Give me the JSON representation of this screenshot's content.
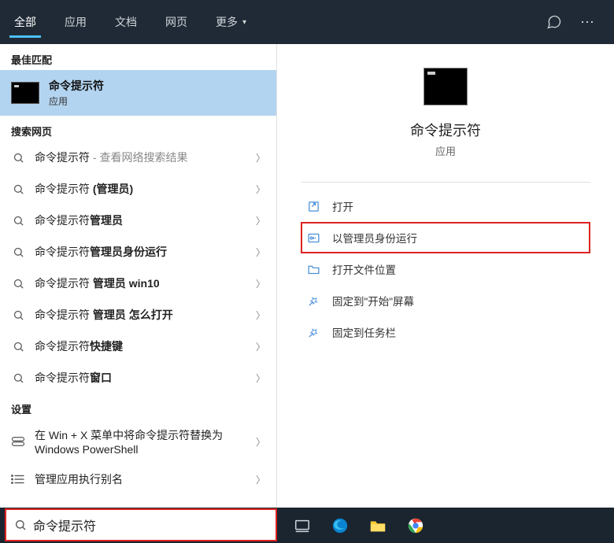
{
  "header": {
    "tabs": [
      {
        "label": "全部",
        "active": true
      },
      {
        "label": "应用"
      },
      {
        "label": "文档"
      },
      {
        "label": "网页"
      },
      {
        "label": "更多",
        "hasChevron": true
      }
    ]
  },
  "sections": {
    "best_match_label": "最佳匹配",
    "web_label": "搜索网页",
    "settings_label": "设置"
  },
  "best_match": {
    "title": "命令提示符",
    "subtitle": "应用"
  },
  "web_results": [
    {
      "prefix": "命令提示符",
      "bold": "",
      "suffix": " - 查看网络搜索结果",
      "suffixMuted": true
    },
    {
      "prefix": "命令提示符 ",
      "bold": "(管理员)",
      "suffix": ""
    },
    {
      "prefix": "命令提示符",
      "bold": "管理员",
      "suffix": ""
    },
    {
      "prefix": "命令提示符",
      "bold": "管理员身份运行",
      "suffix": ""
    },
    {
      "prefix": "命令提示符 ",
      "bold": "管理员 win10",
      "suffix": ""
    },
    {
      "prefix": "命令提示符 ",
      "bold": "管理员 怎么打开",
      "suffix": ""
    },
    {
      "prefix": "命令提示符",
      "bold": "快捷键",
      "suffix": ""
    },
    {
      "prefix": "命令提示符",
      "bold": "窗口",
      "suffix": ""
    }
  ],
  "settings_results": [
    {
      "label": "在 Win + X 菜单中将命令提示符替换为 Windows PowerShell",
      "icon": "toggle"
    },
    {
      "label": "管理应用执行别名",
      "icon": "list"
    }
  ],
  "preview": {
    "title": "命令提示符",
    "subtitle": "应用"
  },
  "actions": [
    {
      "label": "打开",
      "icon": "open"
    },
    {
      "label": "以管理员身份运行",
      "icon": "admin",
      "highlighted": true
    },
    {
      "label": "打开文件位置",
      "icon": "folder"
    },
    {
      "label": "固定到\"开始\"屏幕",
      "icon": "pin"
    },
    {
      "label": "固定到任务栏",
      "icon": "pin"
    }
  ],
  "search": {
    "value": "命令提示符"
  }
}
